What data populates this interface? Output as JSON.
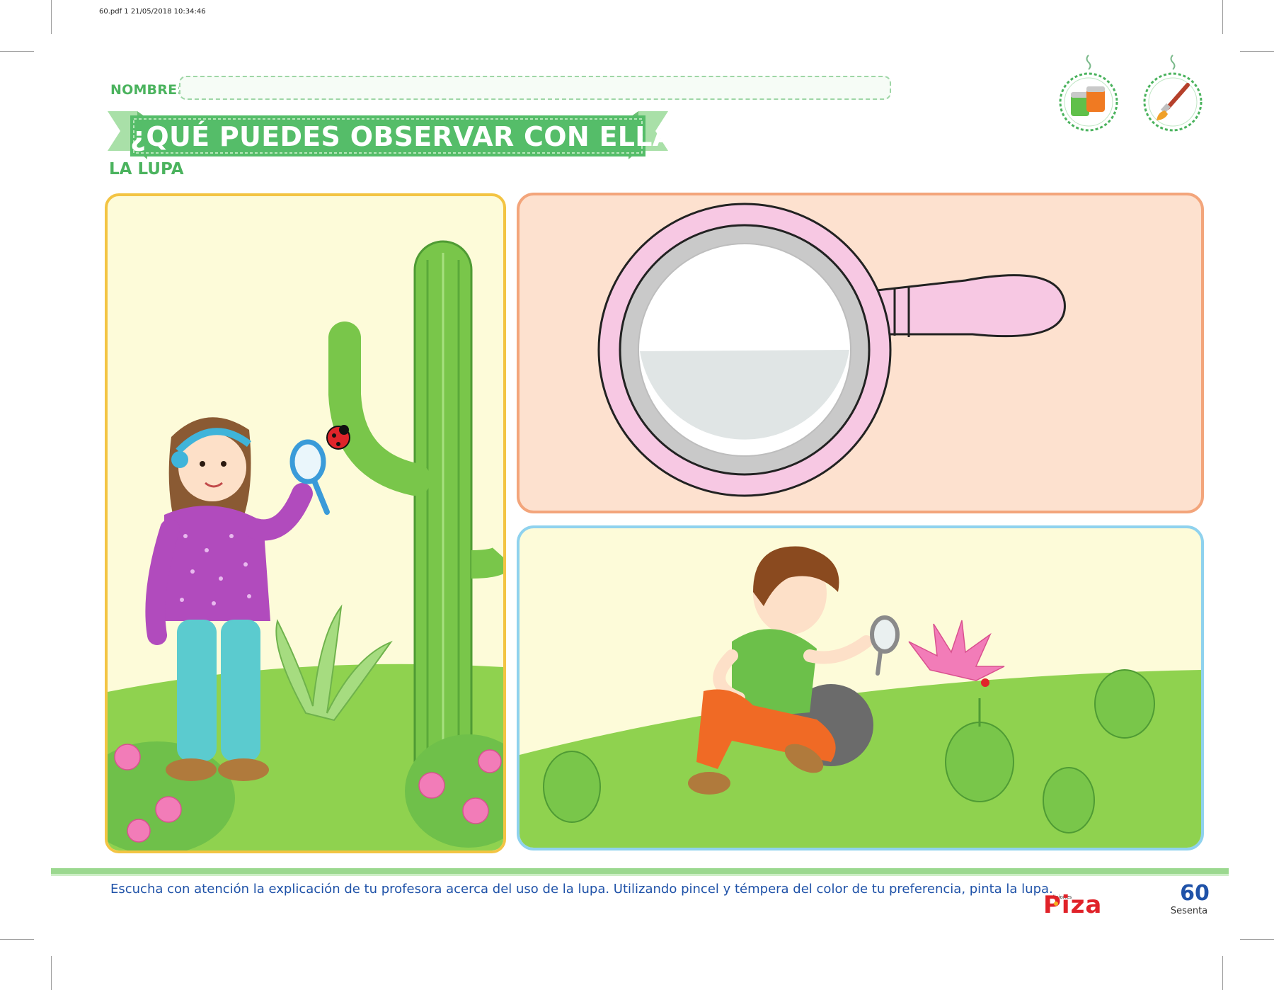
{
  "file_info": "60.pdf  1  21/05/2018  10:34:46",
  "header": {
    "name_label": "NOMBRE:",
    "title": "¿QUÉ PUEDES OBSERVAR CON ELLA?",
    "subtitle": "LA LUPA"
  },
  "badges": [
    "paint-jars-icon",
    "paintbrush-icon"
  ],
  "panels": [
    {
      "scene": "girl-with-magnifier-cactus-ladybug"
    },
    {
      "scene": "magnifying-glass-to-paint"
    },
    {
      "scene": "boy-with-magnifier-flower-ant"
    }
  ],
  "footer": {
    "instruction": "Escucha con atención la explicación de tu profesora acerca del uso de la lupa. Utilizando pincel y témpera del color de tu preferencia, pinta la lupa.",
    "publisher_small": "ediciones",
    "publisher": "Piza",
    "page_number": "60",
    "page_word": "Sesenta"
  },
  "colors": {
    "brand_green": "#4bb35e",
    "text_blue": "#1f52a8",
    "logo_red": "#e02229",
    "panel_a_border": "#f3c443",
    "panel_b_border": "#f3a57b",
    "panel_c_border": "#8fd2ee",
    "magnifier_pink": "#f7c8e3"
  }
}
